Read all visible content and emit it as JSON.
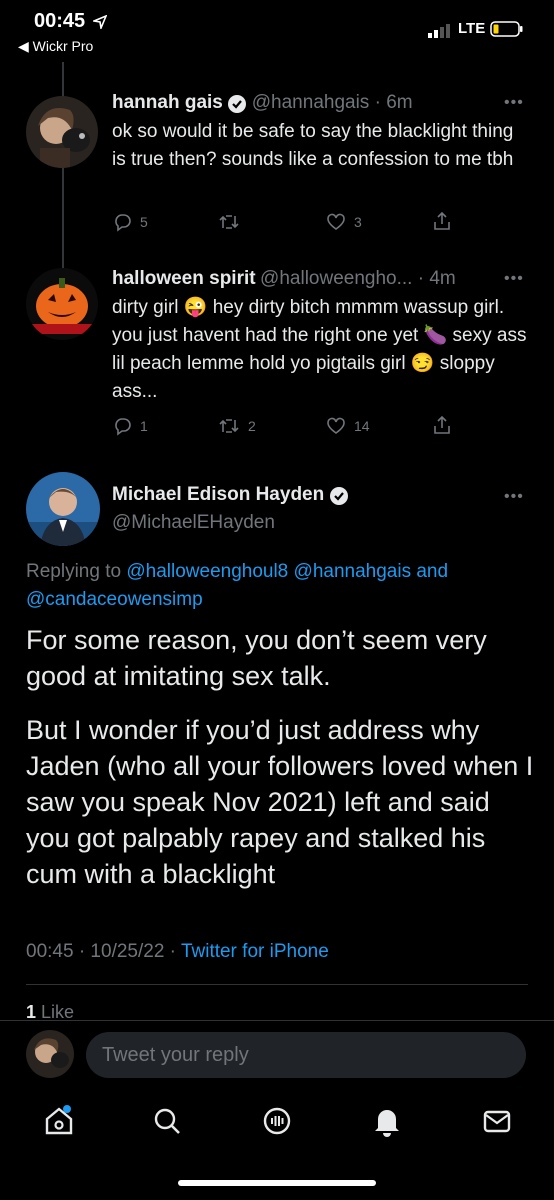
{
  "status": {
    "time": "00:45",
    "back_app": "◀ Wickr Pro",
    "network": "LTE"
  },
  "tweets": [
    {
      "name": "hannah gais",
      "handle": "@hannahgais · 6m",
      "text": "ok so would it be safe to say the blacklight thing is true then? sounds like a confession to me tbh",
      "replies": "5",
      "retweets": "",
      "likes": "3"
    },
    {
      "name": "halloween spirit",
      "handle": "@halloweengho... · 4m",
      "text": "dirty girl 😜 hey dirty bitch mmmm wassup girl. you just havent had the right one yet 🍆 sexy ass lil peach lemme hold yo pigtails girl 😏 sloppy ass...",
      "replies": "1",
      "retweets": "2",
      "likes": "14"
    }
  ],
  "main": {
    "name": "Michael Edison Hayden",
    "handle": "@MichaelEHayden",
    "replying_prefix": "Replying to ",
    "replying_users": "@halloweenghoul8 @hannahgais and",
    "replying_users2": "@candaceowensimp",
    "para1": "For some reason, you don’t seem very good at imitating sex talk.",
    "para2": "But I wonder if you’d just address why Jaden (who all your followers loved when I saw you speak Nov 2021) left and said you got palpably rapey and stalked his cum with a blacklight",
    "meta_time": "00:45 · 10/25/22 · ",
    "meta_client": "Twitter for iPhone",
    "likes_count": "1",
    "likes_label": " Like"
  },
  "reply": {
    "placeholder": "Tweet your reply"
  },
  "colors": {
    "accent": "#1d9bf0",
    "bg": "#000000",
    "muted": "#71767b"
  }
}
